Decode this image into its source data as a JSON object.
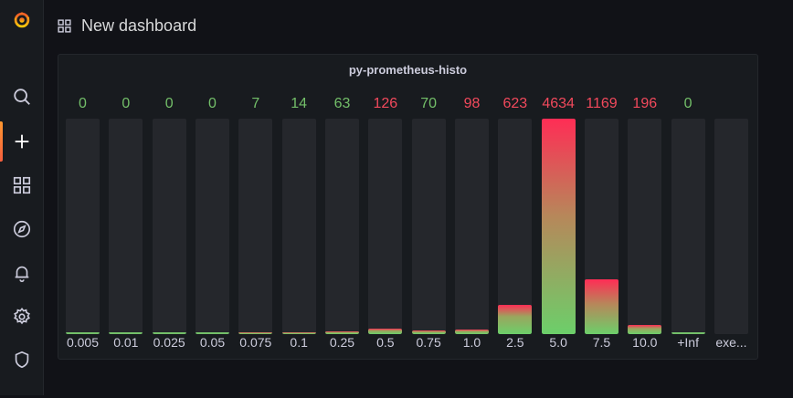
{
  "header": {
    "title": "New dashboard"
  },
  "sidebar": {
    "items": [
      {
        "name": "logo-icon"
      },
      {
        "name": "search-icon"
      },
      {
        "name": "plus-icon"
      },
      {
        "name": "dashboards-icon"
      },
      {
        "name": "explore-icon"
      },
      {
        "name": "alerting-icon"
      },
      {
        "name": "settings-icon"
      },
      {
        "name": "shield-icon"
      }
    ]
  },
  "panel": {
    "title": "py-prometheus-histo"
  },
  "colors": {
    "green": "#73bf69",
    "red": "#f2495c",
    "fill_top_red": "#ff2d55",
    "fill_bottom_green": "#6ccf6a"
  },
  "chart_data": {
    "type": "bar",
    "title": "py-prometheus-histo",
    "categories": [
      "0.005",
      "0.01",
      "0.025",
      "0.05",
      "0.075",
      "0.1",
      "0.25",
      "0.5",
      "0.75",
      "1.0",
      "2.5",
      "5.0",
      "7.5",
      "10.0",
      "+Inf",
      "exe..."
    ],
    "values": [
      0,
      0,
      0,
      0,
      7,
      14,
      63,
      126,
      70,
      98,
      623,
      4634,
      1169,
      196,
      0,
      null
    ],
    "value_labels": [
      "0",
      "0",
      "0",
      "0",
      "7",
      "14",
      "63",
      "126",
      "70",
      "98",
      "623",
      "4634",
      "1169",
      "196",
      "0",
      ""
    ],
    "value_colors": [
      "green",
      "green",
      "green",
      "green",
      "green",
      "green",
      "green",
      "red",
      "green",
      "red",
      "red",
      "red",
      "red",
      "red",
      "green",
      ""
    ],
    "ylim": [
      0,
      4634
    ]
  }
}
